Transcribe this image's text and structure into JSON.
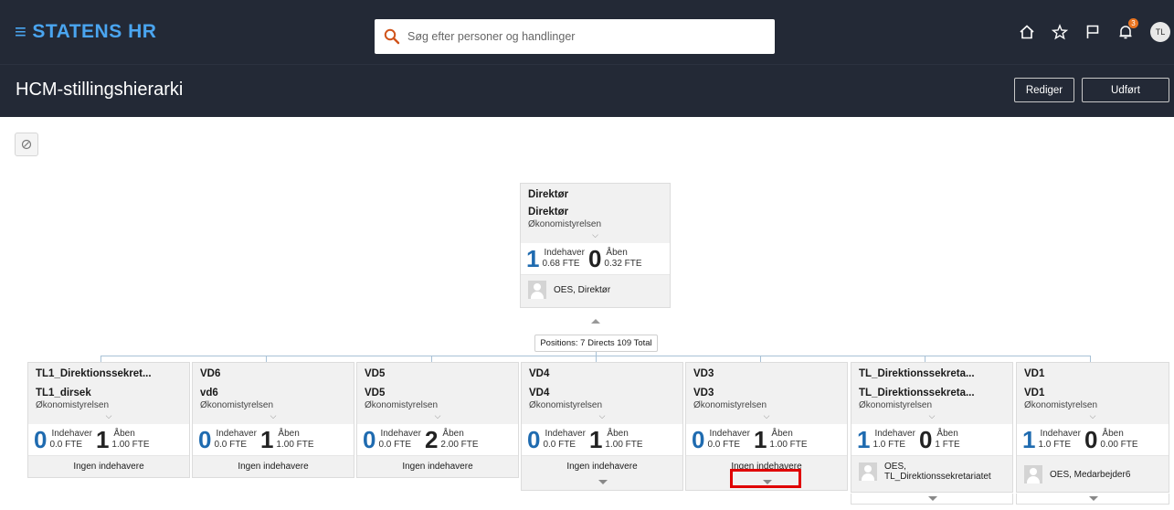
{
  "header": {
    "brand": "STATENS HR",
    "search_placeholder": "Søg efter personer og handlinger",
    "notifications_count": "3",
    "avatar_initials": "TL"
  },
  "titlebar": {
    "title": "HCM-stillingshierarki",
    "edit_label": "Rediger",
    "done_label": "Udført"
  },
  "labels": {
    "holder": "Indehaver",
    "open": "Åben",
    "no_holders": "Ingen indehavere"
  },
  "root": {
    "code": "Direktør",
    "name": "Direktør",
    "org": "Økonomistyrelsen",
    "holder_count": "1",
    "holder_fte": "0.68 FTE",
    "open_count": "0",
    "open_fte": "0.32 FTE",
    "holder_name": "OES, Direktør",
    "summary": "Positions: 7 Directs 109 Total"
  },
  "children": [
    {
      "code": "TL1_Direktionssekret...",
      "name": "TL1_dirsek",
      "org": "Økonomistyrelsen",
      "holder_count": "0",
      "holder_fte": "0.0 FTE",
      "open_count": "1",
      "open_fte": "1.00 FTE",
      "holder_name": ""
    },
    {
      "code": "VD6",
      "name": "vd6",
      "org": "Økonomistyrelsen",
      "holder_count": "0",
      "holder_fte": "0.0 FTE",
      "open_count": "1",
      "open_fte": "1.00 FTE",
      "holder_name": ""
    },
    {
      "code": "VD5",
      "name": "VD5",
      "org": "Økonomistyrelsen",
      "holder_count": "0",
      "holder_fte": "0.0 FTE",
      "open_count": "2",
      "open_fte": "2.00 FTE",
      "holder_name": ""
    },
    {
      "code": "VD4",
      "name": "VD4",
      "org": "Økonomistyrelsen",
      "holder_count": "0",
      "holder_fte": "0.0 FTE",
      "open_count": "1",
      "open_fte": "1.00 FTE",
      "holder_name": ""
    },
    {
      "code": "VD3",
      "name": "VD3",
      "org": "Økonomistyrelsen",
      "holder_count": "0",
      "holder_fte": "0.0 FTE",
      "open_count": "1",
      "open_fte": "1.00 FTE",
      "holder_name": ""
    },
    {
      "code": "TL_Direktionssekreta...",
      "name": "TL_Direktionssekreta...",
      "org": "Økonomistyrelsen",
      "holder_count": "1",
      "holder_fte": "1.0 FTE",
      "open_count": "0",
      "open_fte": "1 FTE",
      "holder_name": "OES, TL_Direktionssekretariatet"
    },
    {
      "code": "VD1",
      "name": "VD1",
      "org": "Økonomistyrelsen",
      "holder_count": "1",
      "holder_fte": "1.0 FTE",
      "open_count": "0",
      "open_fte": "0.00 FTE",
      "holder_name": "OES, Medarbejder6"
    }
  ],
  "colors": {
    "header_bg": "#232936",
    "brand": "#4aa5f0",
    "count_blue": "#1f6bb0",
    "highlight": "#e00000"
  }
}
